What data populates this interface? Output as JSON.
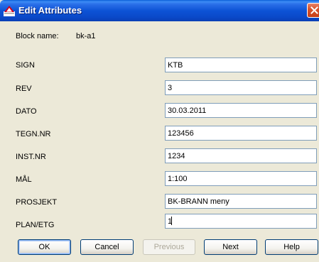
{
  "window": {
    "title": "Edit Attributes"
  },
  "block": {
    "label": "Block name:",
    "value": "bk-a1"
  },
  "fields": [
    {
      "label": "SIGN",
      "value": "KTB"
    },
    {
      "label": "REV",
      "value": "3"
    },
    {
      "label": "DATO",
      "value": "30.03.2011"
    },
    {
      "label": "TEGN.NR",
      "value": "123456"
    },
    {
      "label": "INST.NR",
      "value": "1234"
    },
    {
      "label": "MÅL",
      "value": "1:100"
    },
    {
      "label": "PROSJEKT",
      "value": "BK-BRANN meny"
    },
    {
      "label": "PLAN/ETG",
      "value": "1"
    }
  ],
  "buttons": {
    "ok": "OK",
    "cancel": "Cancel",
    "previous": "Previous",
    "next": "Next",
    "help": "Help"
  },
  "colors": {
    "titlebar": "#0A53D6",
    "dialog_bg": "#ECE9D8",
    "close_button": "#D9542C",
    "input_border": "#7F9DB9"
  },
  "icons": {
    "app": "autocad-icon",
    "close": "close-icon"
  }
}
